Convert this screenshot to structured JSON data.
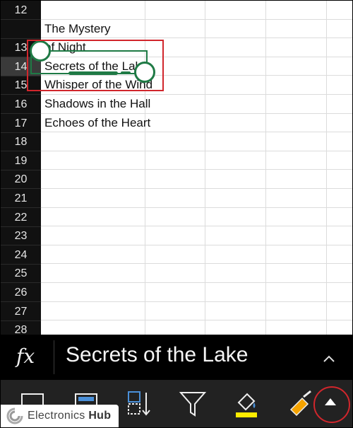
{
  "rows": [
    {
      "num": "12",
      "text": ""
    },
    {
      "num": "",
      "text": "The Mystery"
    },
    {
      "num": "13",
      "text": "of Night"
    },
    {
      "num": "14",
      "text": "Secrets of the Lake"
    },
    {
      "num": "15",
      "text": "Whisper of the Wind"
    },
    {
      "num": "16",
      "text": "Shadows in the Hall"
    },
    {
      "num": "17",
      "text": "Echoes of the Heart"
    },
    {
      "num": "18",
      "text": ""
    },
    {
      "num": "19",
      "text": ""
    },
    {
      "num": "20",
      "text": ""
    },
    {
      "num": "21",
      "text": ""
    },
    {
      "num": "22",
      "text": ""
    },
    {
      "num": "23",
      "text": ""
    },
    {
      "num": "24",
      "text": ""
    },
    {
      "num": "25",
      "text": ""
    },
    {
      "num": "26",
      "text": ""
    },
    {
      "num": "27",
      "text": ""
    },
    {
      "num": "28",
      "text": ""
    }
  ],
  "formula_bar": {
    "fx_label": "fx",
    "value": "Secrets of the Lake",
    "collapse_icon": "chevron-up-icon"
  },
  "toolbar": {
    "items": [
      "copy-format-icon",
      "paste-format-icon",
      "sort-icon",
      "filter-icon",
      "fill-color-icon",
      "clear-format-icon",
      "expand-up-icon"
    ],
    "fill_color": "#ffec00"
  },
  "watermark": {
    "brand_first": "Electronics",
    "brand_second": "Hub"
  },
  "colors": {
    "selection": "#1f7a45",
    "annotation": "#d1262c"
  }
}
